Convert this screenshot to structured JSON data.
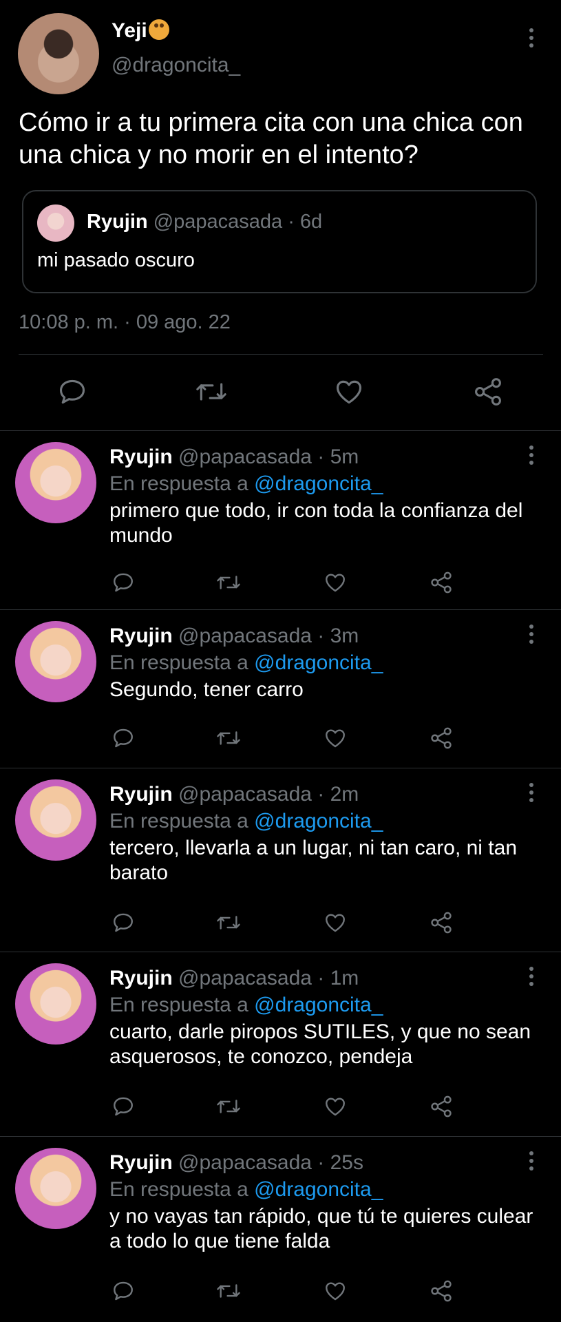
{
  "main_tweet": {
    "author_name": "Yeji",
    "author_handle": "@dragoncita_",
    "text": "Cómo ir a tu primera cita con una chica con una chica y no morir en el intento?",
    "timestamp": "10:08 p. m. · 09 ago. 22",
    "quoted": {
      "name": "Ryujin",
      "meta": "@papacasada · 6d",
      "text": "mi pasado oscuro"
    }
  },
  "replies": [
    {
      "name": "Ryujin",
      "meta": "@papacasada · 5m",
      "prefix": "En respuesta a",
      "mention": "@dragoncita_",
      "text": "primero que todo, ir con toda la confianza del mundo"
    },
    {
      "name": "Ryujin",
      "meta": "@papacasada · 3m",
      "prefix": "En respuesta a",
      "mention": "@dragoncita_",
      "text": "Segundo, tener carro"
    },
    {
      "name": "Ryujin",
      "meta": "@papacasada · 2m",
      "prefix": "En respuesta a",
      "mention": "@dragoncita_",
      "text": "tercero, llevarla a un lugar, ni tan caro, ni tan barato"
    },
    {
      "name": "Ryujin",
      "meta": "@papacasada · 1m",
      "prefix": "En respuesta a",
      "mention": "@dragoncita_",
      "text": "cuarto, darle piropos SUTILES, y que no sean asquerosos, te conozco, pendeja"
    },
    {
      "name": "Ryujin",
      "meta": "@papacasada · 25s",
      "prefix": "En respuesta a",
      "mention": "@dragoncita_",
      "text": "y no vayas tan rápido, que tú te quieres culear a todo lo que tiene falda"
    }
  ],
  "icons": [
    "reply-icon",
    "retweet-icon",
    "like-icon",
    "share-icon",
    "more-icon"
  ],
  "colors": {
    "background": "#000000",
    "text": "#e7e9ea",
    "muted": "#71767b",
    "link": "#1d9bf0",
    "divider": "#2f3336"
  }
}
